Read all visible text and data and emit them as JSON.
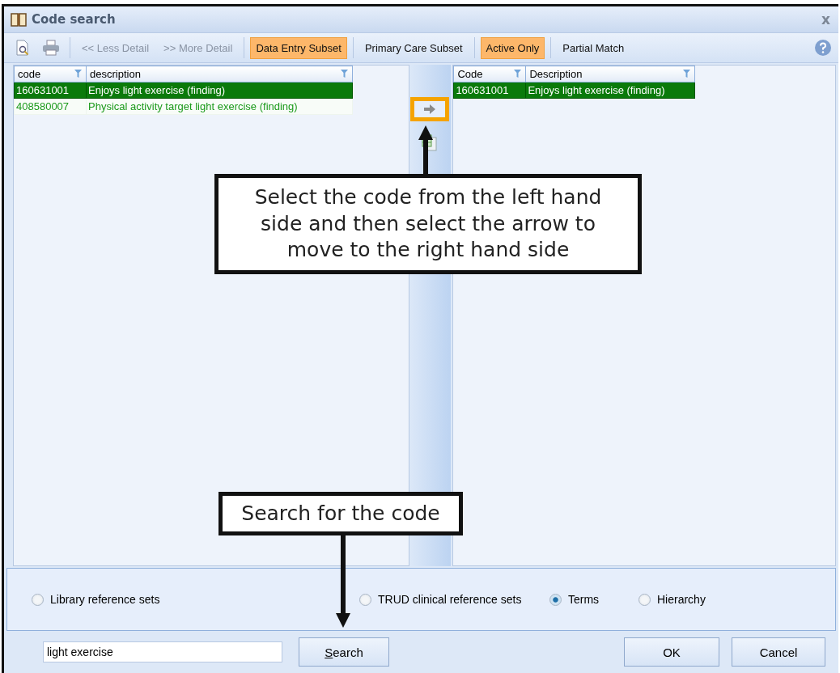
{
  "window": {
    "title": "Code search",
    "close": "x"
  },
  "toolbar": {
    "detail_buttons": [
      {
        "label": "<< Less Detail",
        "disabled": true
      },
      {
        "label": ">> More Detail",
        "disabled": true
      }
    ],
    "toggles": [
      {
        "label": "Data Entry Subset",
        "on": true
      },
      {
        "label": "Primary Care Subset",
        "on": false
      },
      {
        "label": "Active Only",
        "on": true
      },
      {
        "label": "Partial Match",
        "on": false
      }
    ]
  },
  "left_grid": {
    "columns": [
      "code",
      "description"
    ],
    "rows": [
      {
        "code": "160631001",
        "description": "Enjoys light exercise (finding)",
        "selected": true
      },
      {
        "code": "408580007",
        "description": "Physical activity target light exercise (finding)",
        "selected": false
      }
    ]
  },
  "move_button": {
    "highlighted": true
  },
  "right_grid": {
    "columns": [
      "Code",
      "Description"
    ],
    "rows": [
      {
        "code": "160631001",
        "description": "Enjoys light exercise (finding)",
        "selected": true
      }
    ]
  },
  "search_modes": [
    {
      "label": "Library reference sets",
      "selected": false
    },
    {
      "label": "TRUD clinical reference sets",
      "selected": false
    },
    {
      "label": "Terms",
      "selected": true
    },
    {
      "label": "Hierarchy",
      "selected": false
    }
  ],
  "search_field": {
    "value": "light exercise"
  },
  "buttons": [
    {
      "label": "Search",
      "kind": "search"
    },
    {
      "label": "OK",
      "kind": "ok"
    },
    {
      "label": "Cancel",
      "kind": "cancel"
    }
  ],
  "callouts": [
    {
      "text": "Select the code from the left hand side and then select the arrow to move to the right hand side"
    },
    {
      "text": "Search for the code"
    }
  ]
}
